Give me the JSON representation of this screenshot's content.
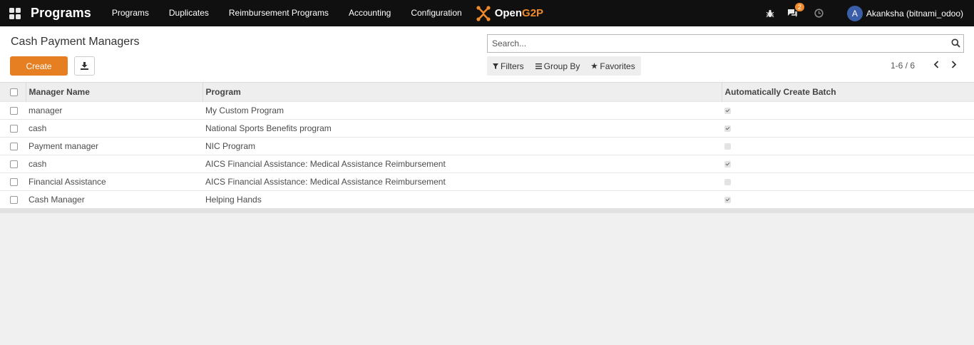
{
  "navbar": {
    "app_title": "Programs",
    "menu": [
      "Programs",
      "Duplicates",
      "Reimbursement Programs",
      "Accounting",
      "Configuration"
    ],
    "logo_text_a": "Open",
    "logo_text_b": "G2P",
    "chat_badge": "2",
    "avatar_initial": "A",
    "user": "Akanksha (bitnami_odoo)",
    "icons": [
      "apps-grid-icon",
      "bug-icon",
      "chat-icon",
      "clock-icon"
    ]
  },
  "control": {
    "title": "Cash Payment Managers",
    "create_label": "Create",
    "search_placeholder": "Search...",
    "filters_label": "Filters",
    "groupby_label": "Group By",
    "favorites_label": "Favorites",
    "pager": "1-6 / 6"
  },
  "table": {
    "columns": [
      "Manager Name",
      "Program",
      "Automatically Create Batch"
    ],
    "rows": [
      {
        "name": "manager",
        "program": "My Custom Program",
        "auto": true
      },
      {
        "name": "cash",
        "program": "National Sports Benefits program",
        "auto": true
      },
      {
        "name": "Payment manager",
        "program": "NIC Program",
        "auto": false
      },
      {
        "name": "cash",
        "program": "AICS Financial Assistance: Medical Assistance Reimbursement",
        "auto": true
      },
      {
        "name": "Financial Assistance",
        "program": "AICS Financial Assistance: Medical Assistance Reimbursement",
        "auto": false
      },
      {
        "name": "Cash Manager",
        "program": "Helping Hands",
        "auto": true
      }
    ]
  },
  "colors": {
    "navbar": "#101010",
    "accent": "#e67e22",
    "avatar": "#3a5ea8"
  }
}
